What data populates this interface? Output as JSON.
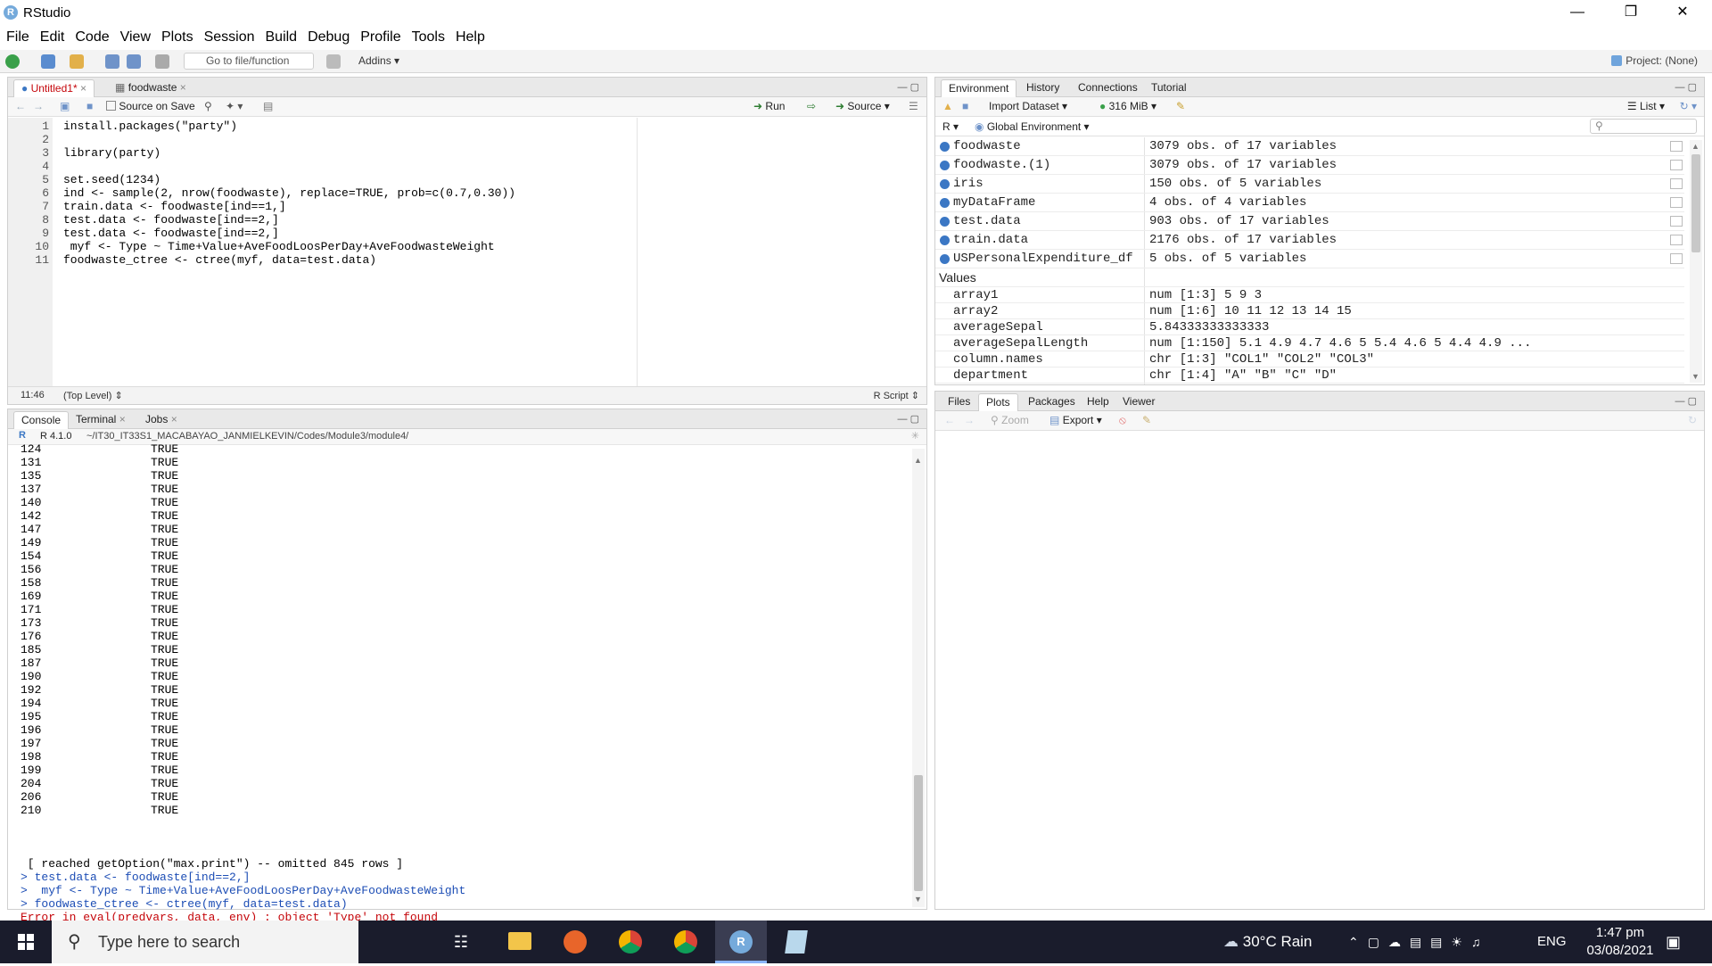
{
  "window": {
    "title": "RStudio",
    "app_icon_letter": "R"
  },
  "menu": [
    "File",
    "Edit",
    "Code",
    "View",
    "Plots",
    "Session",
    "Build",
    "Debug",
    "Profile",
    "Tools",
    "Help"
  ],
  "toolbar": {
    "goto_placeholder": "Go to file/function",
    "addins": "Addins",
    "project": "Project: (None)"
  },
  "editor": {
    "tabs": [
      "Untitled1*",
      "foodwaste"
    ],
    "source_on_save": "Source on Save",
    "run": "Run",
    "source": "Source",
    "lines": [
      {
        "n": "1",
        "text": "install.packages(\"party\")"
      },
      {
        "n": "2",
        "text": ""
      },
      {
        "n": "3",
        "text": "library(party)"
      },
      {
        "n": "4",
        "text": ""
      },
      {
        "n": "5",
        "text": "set.seed(1234)"
      },
      {
        "n": "6",
        "text": "ind <- sample(2, nrow(foodwaste), replace=TRUE, prob=c(0.7,0.30))"
      },
      {
        "n": "7",
        "text": "train.data <- foodwaste[ind==1,]"
      },
      {
        "n": "8",
        "text": "test.data <- foodwaste[ind==2,]"
      },
      {
        "n": "9",
        "text": "test.data <- foodwaste[ind==2,]"
      },
      {
        "n": "10",
        "text": " myf <- Type ~ Time+Value+AveFoodLoosPerDay+AveFoodwasteWeight"
      },
      {
        "n": "11",
        "text": "foodwaste_ctree <- ctree(myf, data=test.data)"
      }
    ],
    "status_pos": "11:46",
    "status_level": "(Top Level)",
    "status_type": "R Script"
  },
  "console": {
    "tabs": [
      "Console",
      "Terminal",
      "Jobs"
    ],
    "version": "R 4.1.0",
    "path": "~/IT30_IT33S1_MACABAYAO_JANMIELKEVIN/Codes/Module3/module4/",
    "rows": [
      [
        "124",
        "TRUE"
      ],
      [
        "131",
        "TRUE"
      ],
      [
        "135",
        "TRUE"
      ],
      [
        "137",
        "TRUE"
      ],
      [
        "140",
        "TRUE"
      ],
      [
        "142",
        "TRUE"
      ],
      [
        "147",
        "TRUE"
      ],
      [
        "149",
        "TRUE"
      ],
      [
        "154",
        "TRUE"
      ],
      [
        "156",
        "TRUE"
      ],
      [
        "158",
        "TRUE"
      ],
      [
        "169",
        "TRUE"
      ],
      [
        "171",
        "TRUE"
      ],
      [
        "173",
        "TRUE"
      ],
      [
        "176",
        "TRUE"
      ],
      [
        "185",
        "TRUE"
      ],
      [
        "187",
        "TRUE"
      ],
      [
        "190",
        "TRUE"
      ],
      [
        "192",
        "TRUE"
      ],
      [
        "194",
        "TRUE"
      ],
      [
        "195",
        "TRUE"
      ],
      [
        "196",
        "TRUE"
      ],
      [
        "197",
        "TRUE"
      ],
      [
        "198",
        "TRUE"
      ],
      [
        "199",
        "TRUE"
      ],
      [
        "204",
        "TRUE"
      ],
      [
        "206",
        "TRUE"
      ],
      [
        "210",
        "TRUE"
      ]
    ],
    "omitted": " [ reached getOption(\"max.print\") -- omitted 845 rows ]",
    "cmd1": "> test.data <- foodwaste[ind==2,]",
    "cmd2": ">  myf <- Type ~ Time+Value+AveFoodLoosPerDay+AveFoodwasteWeight",
    "cmd3": "> foodwaste_ctree <- ctree(myf, data=test.data)",
    "error": "Error in eval(predvars, data, env) : object 'Type' not found",
    "prompt": "> "
  },
  "environment": {
    "tabs": [
      "Environment",
      "History",
      "Connections",
      "Tutorial"
    ],
    "import": "Import Dataset",
    "memory": "316 MiB",
    "view": "List",
    "lang": "R",
    "scope": "Global Environment",
    "data": [
      {
        "name": "foodwaste",
        "value": "3079 obs. of 17 variables"
      },
      {
        "name": "foodwaste.(1)",
        "value": "3079 obs. of 17 variables"
      },
      {
        "name": "iris",
        "value": "150 obs. of 5 variables"
      },
      {
        "name": "myDataFrame",
        "value": "4 obs. of 4 variables"
      },
      {
        "name": "test.data",
        "value": "903 obs. of 17 variables"
      },
      {
        "name": "train.data",
        "value": "2176 obs. of 17 variables"
      },
      {
        "name": "USPersonalExpenditure_df",
        "value": "5 obs. of 5 variables"
      }
    ],
    "values_header": "Values",
    "values": [
      {
        "name": "array1",
        "value": "num [1:3] 5 9 3"
      },
      {
        "name": "array2",
        "value": "num [1:6] 10 11 12 13 14 15"
      },
      {
        "name": "averageSepal",
        "value": "5.84333333333333"
      },
      {
        "name": "averageSepalLength",
        "value": "num [1:150] 5.1 4.9 4.7 4.6 5 5.4 4.6 5 4.4 4.9 ..."
      },
      {
        "name": "column.names",
        "value": "chr [1:3] \"COL1\" \"COL2\" \"COL3\""
      },
      {
        "name": "department",
        "value": "chr [1:4] \"A\" \"B\" \"C\" \"D\""
      }
    ]
  },
  "files": {
    "tabs": [
      "Files",
      "Plots",
      "Packages",
      "Help",
      "Viewer"
    ],
    "zoom": "Zoom",
    "export": "Export"
  },
  "taskbar": {
    "search_placeholder": "Type here to search",
    "weather": "30°C  Rain",
    "lang": "ENG",
    "time": "1:47 pm",
    "date": "03/08/2021"
  }
}
